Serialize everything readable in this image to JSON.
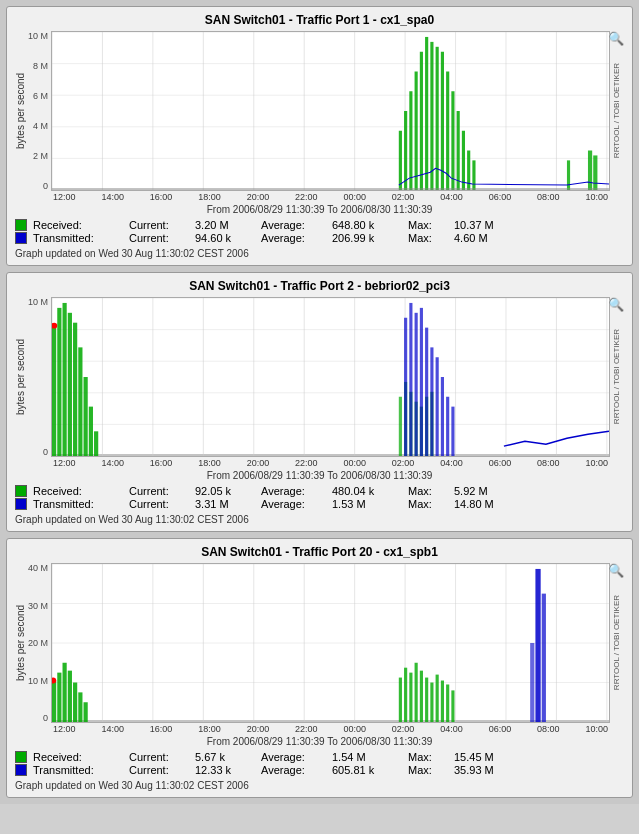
{
  "graphs": [
    {
      "id": "graph1",
      "title": "SAN Switch01 - Traffic Port 1 - cx1_spa0",
      "y_label": "bytes per second",
      "side_label": "RRTOOL / TOBI OETIKER",
      "x_ticks": [
        "12:00",
        "14:00",
        "16:00",
        "18:00",
        "20:00",
        "22:00",
        "00:00",
        "02:00",
        "04:00",
        "06:00",
        "08:00",
        "10:00"
      ],
      "y_ticks": [
        "10 M",
        "8 M",
        "6 M",
        "4 M",
        "2 M",
        "0"
      ],
      "time_range": "From 2006/08/29 11:30:39 To 2006/08/30 11:30:39",
      "received": {
        "label": "Received:",
        "current_label": "Current:",
        "current_val": "3.20 M",
        "avg_label": "Average:",
        "avg_val": "648.80 k",
        "max_label": "Max:",
        "max_val": "10.37 M"
      },
      "transmitted": {
        "label": "Transmitted:",
        "current_label": "Current:",
        "current_val": "94.60 k",
        "avg_label": "Average:",
        "avg_val": "206.99 k",
        "max_label": "Max:",
        "max_val": "4.60 M"
      },
      "updated": "Graph updated on Wed 30 Aug 11:30:02 CEST 2006",
      "received_color": "#00aa00",
      "transmitted_color": "#0000cc"
    },
    {
      "id": "graph2",
      "title": "SAN Switch01 - Traffic Port 2 - bebrior02_pci3",
      "y_label": "bytes per second",
      "side_label": "RRTOOL / TOBI OETIKER",
      "x_ticks": [
        "12:00",
        "14:00",
        "16:00",
        "18:00",
        "20:00",
        "22:00",
        "00:00",
        "02:00",
        "04:00",
        "06:00",
        "08:00",
        "10:00"
      ],
      "y_ticks": [
        "10 M",
        "",
        "",
        "",
        "",
        "0"
      ],
      "time_range": "From 2006/08/29 11:30:39 To 2006/08/30 11:30:39",
      "received": {
        "label": "Received:",
        "current_label": "Current:",
        "current_val": "92.05 k",
        "avg_label": "Average:",
        "avg_val": "480.04 k",
        "max_label": "Max:",
        "max_val": "5.92 M"
      },
      "transmitted": {
        "label": "Transmitted:",
        "current_label": "Current:",
        "current_val": "3.31 M",
        "avg_label": "Average:",
        "avg_val": "1.53 M",
        "max_label": "Max:",
        "max_val": "14.80 M"
      },
      "updated": "Graph updated on Wed 30 Aug 11:30:02 CEST 2006",
      "received_color": "#00aa00",
      "transmitted_color": "#0000cc"
    },
    {
      "id": "graph3",
      "title": "SAN Switch01 - Traffic Port 20 - cx1_spb1",
      "y_label": "bytes per second",
      "side_label": "RRTOOL / TOBI OETIKER",
      "x_ticks": [
        "12:00",
        "14:00",
        "16:00",
        "18:00",
        "20:00",
        "22:00",
        "00:00",
        "02:00",
        "04:00",
        "06:00",
        "08:00",
        "10:00"
      ],
      "y_ticks": [
        "40 M",
        "30 M",
        "20 M",
        "10 M",
        "0"
      ],
      "time_range": "From 2006/08/29 11:30:39 To 2006/08/30 11:30:39",
      "received": {
        "label": "Received:",
        "current_label": "Current:",
        "current_val": "5.67 k",
        "avg_label": "Average:",
        "avg_val": "1.54 M",
        "max_label": "Max:",
        "max_val": "15.45 M"
      },
      "transmitted": {
        "label": "Transmitted:",
        "current_label": "Current:",
        "current_val": "12.33 k",
        "avg_label": "Average:",
        "avg_val": "605.81 k",
        "max_label": "Max:",
        "max_val": "35.93 M"
      },
      "updated": "Graph updated on Wed 30 Aug 11:30:02 CEST 2006",
      "received_color": "#00aa00",
      "transmitted_color": "#0000cc"
    }
  ],
  "zoom_icon": "🔍"
}
